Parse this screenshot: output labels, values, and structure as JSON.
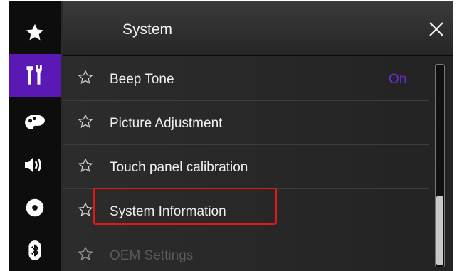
{
  "header": {
    "title": "System"
  },
  "sidebar": {
    "items": [
      {
        "icon": "star-icon",
        "active": false
      },
      {
        "icon": "tools-icon",
        "active": true
      },
      {
        "icon": "palette-icon",
        "active": false
      },
      {
        "icon": "speaker-icon",
        "active": false
      },
      {
        "icon": "disc-icon",
        "active": false
      },
      {
        "icon": "bluetooth-icon",
        "active": false
      }
    ]
  },
  "menu": {
    "items": [
      {
        "label": "Beep Tone",
        "value": "On"
      },
      {
        "label": "Picture Adjustment",
        "value": ""
      },
      {
        "label": "Touch panel calibration",
        "value": ""
      },
      {
        "label": "System Information",
        "value": "",
        "highlighted": true
      },
      {
        "label": "OEM Settings",
        "value": "",
        "disabled": true
      }
    ]
  },
  "colors": {
    "accent": "#5a18b5",
    "value_text": "#6a2ad0",
    "highlight_box": "#e01818"
  }
}
